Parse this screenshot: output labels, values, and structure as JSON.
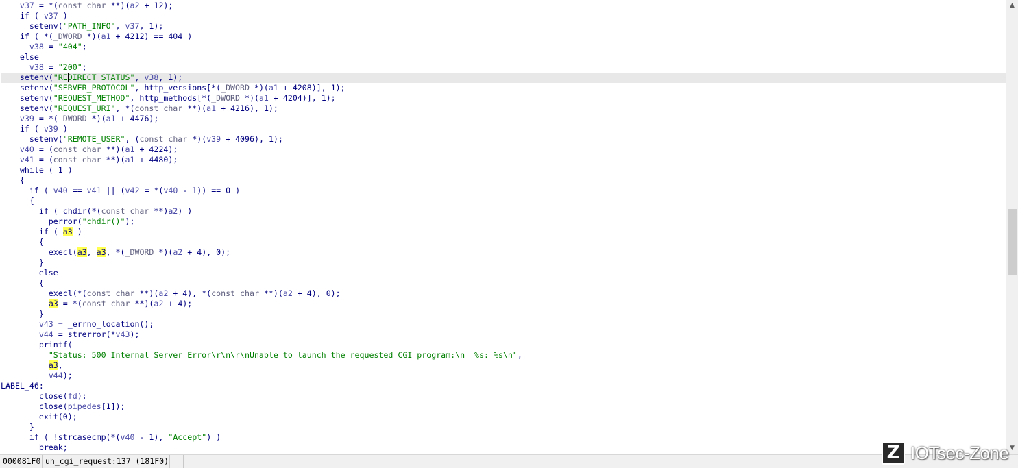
{
  "code_lines": [
    "    v37 = *(const char **)(a2 + 12);",
    "    if ( v37 )",
    "      setenv(\"PATH_INFO\", v37, 1);",
    "    if ( *(_DWORD *)(a1 + 4212) == 404 )",
    "      v38 = \"404\";",
    "    else",
    "      v38 = \"200\";",
    "    setenv(\"REDIRECT_STATUS\", v38, 1);",
    "    setenv(\"SERVER_PROTOCOL\", http_versions[*(_DWORD *)(a1 + 4208)], 1);",
    "    setenv(\"REQUEST_METHOD\", http_methods[*(_DWORD *)(a1 + 4204)], 1);",
    "    setenv(\"REQUEST_URI\", *(const char **)(a1 + 4216), 1);",
    "    v39 = *(_DWORD *)(a1 + 4476);",
    "    if ( v39 )",
    "      setenv(\"REMOTE_USER\", (const char *)(v39 + 4096), 1);",
    "    v40 = (const char **)(a1 + 4224);",
    "    v41 = (const char **)(a1 + 4480);",
    "    while ( 1 )",
    "    {",
    "      if ( v40 == v41 || (v42 = *(v40 - 1)) == 0 )",
    "      {",
    "        if ( chdir(*(const char **)a2) )",
    "          perror(\"chdir()\");",
    "        if ( a3 )",
    "        {",
    "          execl(a3, a3, *(_DWORD *)(a2 + 4), 0);",
    "        }",
    "        else",
    "        {",
    "          execl(*(const char **)(a2 + 4), *(const char **)(a2 + 4), 0);",
    "          a3 = *(const char **)(a2 + 4);",
    "        }",
    "        v43 = _errno_location();",
    "        v44 = strerror(*v43);",
    "        printf(",
    "          \"Status: 500 Internal Server Error\\r\\n\\r\\nUnable to launch the requested CGI program:\\n  %s: %s\\n\",",
    "          a3,",
    "          v44);",
    "LABEL_46:",
    "        close(fd);",
    "        close(pipedes[1]);",
    "        exit(0);",
    "      }",
    "      if ( !strcasecmp(*(v40 - 1), \"Accept\") )",
    "        break;"
  ],
  "highlighted_line_index": 7,
  "highlight_word": "a3",
  "status_bar": {
    "address": "000081F0",
    "function": "uh_cgi_request:137 (181F0)"
  },
  "watermark": {
    "logo_letter": "Z",
    "text": "IOTsec-Zone"
  },
  "colors": {
    "keyword_text": "#000080",
    "variable": "#4a4aa8",
    "type_cast": "#606080",
    "string": "#008000",
    "word_highlight": "#ffff50",
    "current_line": "#e8e8e8"
  },
  "icons": {
    "scroll_up": "triangle-up-icon",
    "scroll_down": "triangle-down-icon"
  }
}
